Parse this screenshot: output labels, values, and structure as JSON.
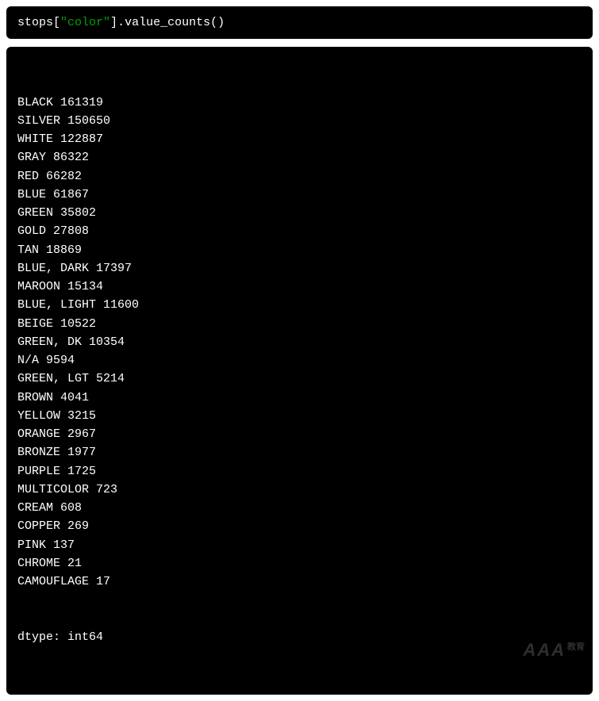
{
  "code": {
    "var": "stops",
    "open_bracket": "[",
    "string": "\"color\"",
    "close_bracket": "]",
    "dot": ".",
    "method": "value_counts",
    "parens": "()"
  },
  "output": {
    "rows": [
      {
        "label": "BLACK",
        "count": "161319"
      },
      {
        "label": "SILVER",
        "count": "150650"
      },
      {
        "label": "WHITE",
        "count": "122887"
      },
      {
        "label": "GRAY",
        "count": "86322"
      },
      {
        "label": "RED",
        "count": "66282"
      },
      {
        "label": "BLUE",
        "count": "61867"
      },
      {
        "label": "GREEN",
        "count": "35802"
      },
      {
        "label": "GOLD",
        "count": "27808"
      },
      {
        "label": "TAN",
        "count": "18869"
      },
      {
        "label": "BLUE, DARK",
        "count": "17397"
      },
      {
        "label": "MAROON",
        "count": "15134"
      },
      {
        "label": "BLUE, LIGHT",
        "count": "11600"
      },
      {
        "label": "BEIGE",
        "count": "10522"
      },
      {
        "label": "GREEN, DK",
        "count": "10354"
      },
      {
        "label": "N/A",
        "count": "9594"
      },
      {
        "label": "GREEN, LGT",
        "count": "5214"
      },
      {
        "label": "BROWN",
        "count": "4041"
      },
      {
        "label": "YELLOW",
        "count": "3215"
      },
      {
        "label": "ORANGE",
        "count": "2967"
      },
      {
        "label": "BRONZE",
        "count": "1977"
      },
      {
        "label": "PURPLE",
        "count": "1725"
      },
      {
        "label": "MULTICOLOR",
        "count": "723"
      },
      {
        "label": "CREAM",
        "count": "608"
      },
      {
        "label": "COPPER",
        "count": "269"
      },
      {
        "label": "PINK",
        "count": "137"
      },
      {
        "label": "CHROME",
        "count": "21"
      },
      {
        "label": "CAMOUFLAGE",
        "count": "17"
      }
    ],
    "dtype_line": "dtype: int64"
  },
  "watermark": {
    "main": "AAA",
    "sub": "教育"
  }
}
